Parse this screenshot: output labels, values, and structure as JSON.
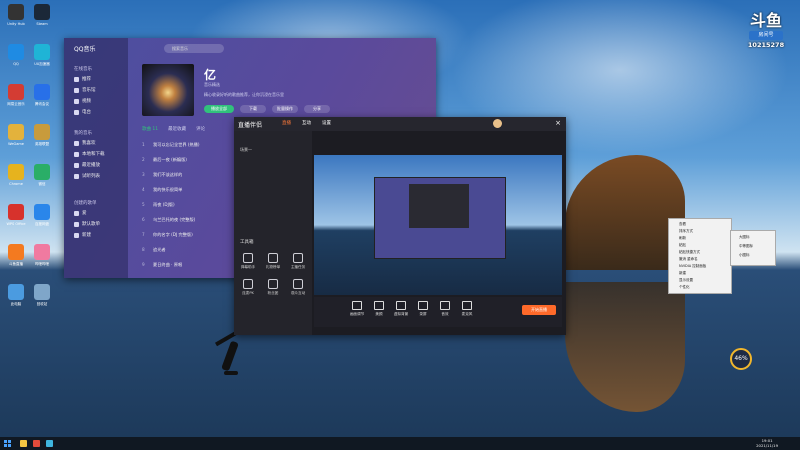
{
  "desktop": {
    "icons": [
      {
        "label": "Unity Hub",
        "color": "#333333"
      },
      {
        "label": "Steam",
        "color": "#1b2838"
      },
      {
        "label": "QQ",
        "color": "#1f8be3"
      },
      {
        "label": "UU加速器",
        "color": "#1fb4d6"
      },
      {
        "label": "网易云音乐",
        "color": "#d43c33"
      },
      {
        "label": "腾讯会议",
        "color": "#2870e8"
      },
      {
        "label": "WeGame",
        "color": "#e3b23c"
      },
      {
        "label": "英雄联盟",
        "color": "#c89b3c"
      },
      {
        "label": "Chrome",
        "color": "#e6b31e"
      },
      {
        "label": "微信",
        "color": "#2aae67"
      },
      {
        "label": "WPS Office",
        "color": "#d7322c"
      },
      {
        "label": "百度网盘",
        "color": "#2a86ea"
      },
      {
        "label": "斗鱼直播",
        "color": "#f47a20"
      },
      {
        "label": "哔哩哔哩",
        "color": "#f07aa0"
      },
      {
        "label": "此电脑",
        "color": "#4b9be0"
      },
      {
        "label": "回收站",
        "color": "#7fa6c9"
      }
    ]
  },
  "qq_music": {
    "logo": "QQ音乐",
    "search_placeholder": "搜索音乐",
    "side_head_online": "在线音乐",
    "side_items_online": [
      "推荐",
      "音乐馆",
      "视频",
      "电台"
    ],
    "side_head_mine": "我的音乐",
    "side_items_mine": [
      "我喜欢",
      "本地和下载",
      "最近播放",
      "试听列表"
    ],
    "side_head_created": "创建的歌单",
    "side_items_created": [
      "爱",
      "默认歌单",
      "新建"
    ],
    "song_title": "亿",
    "song_artist": "音乐精选",
    "song_desc": "精心收录好听的歌曲推荐，让你沉浸在音乐里",
    "play_all": "播放全部",
    "download": "下载",
    "batch": "批量操作",
    "share": "分享",
    "tabs": [
      "歌曲 11",
      "最近收藏",
      "评论"
    ],
    "tracks": [
      {
        "n": "1",
        "name": "我可以忘记全世界 (热播)"
      },
      {
        "n": "2",
        "name": "最后一夜 (新编版)"
      },
      {
        "n": "3",
        "name": "我们不该这样的"
      },
      {
        "n": "4",
        "name": "我的快乐很简单"
      },
      {
        "n": "5",
        "name": "雨夜 (DJ版)"
      },
      {
        "n": "6",
        "name": "乌兰巴托的夜 (完整版)"
      },
      {
        "n": "7",
        "name": "你的名字 (DJ 完整版)"
      },
      {
        "n": "8",
        "name": "追光者"
      },
      {
        "n": "9",
        "name": "夏日终曲 · 原唱"
      }
    ]
  },
  "live_app": {
    "logo": "直播伴侣",
    "tabs": [
      "直播",
      "互动",
      "设置"
    ],
    "scene_label": "场景一",
    "tools_head": "工具箱",
    "tools": [
      "弹幕助手",
      "礼物榜单",
      "主播任务",
      "连麦PK",
      "粉丝团",
      "观众互动"
    ],
    "bottom_tools": [
      "画面调节",
      "美颜",
      "虚拟背景",
      "录屏",
      "音效",
      "麦克风"
    ],
    "go_live": "开始直播"
  },
  "context_menu": {
    "items": [
      "查看",
      "排序方式",
      "刷新",
      "粘贴",
      "粘贴快捷方式",
      "撤消 重命名",
      "NVIDIA 控制面板",
      "新建",
      "显示设置",
      "个性化"
    ],
    "sub_items": [
      "大图标",
      "中等图标",
      "小图标"
    ]
  },
  "watermark": {
    "brand": "斗鱼",
    "room_label": "房间号",
    "room_number": "10215278"
  },
  "overlay": {
    "percent": "46%"
  },
  "taskbar": {
    "time": "19:01",
    "date": "2021/11/19"
  }
}
